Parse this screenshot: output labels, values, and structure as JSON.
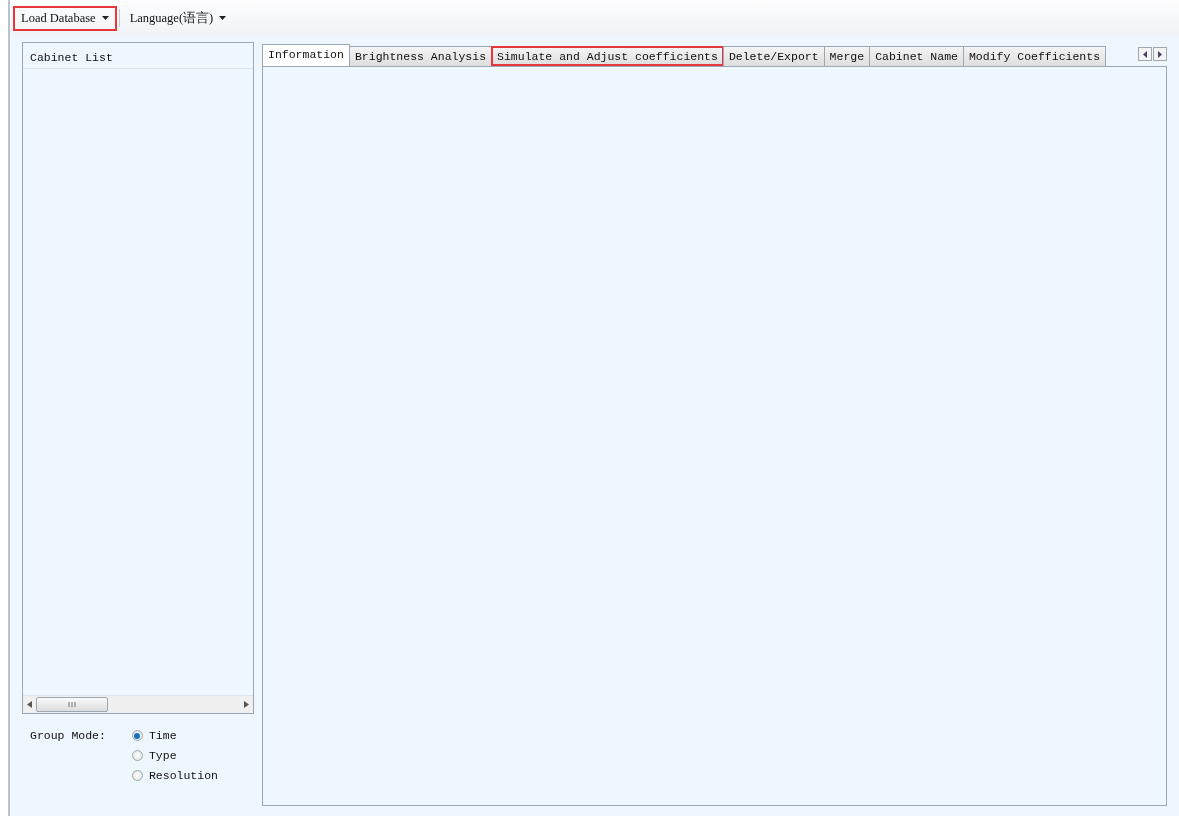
{
  "toolbar": {
    "menus": [
      {
        "label": "Load Database",
        "highlighted": true
      },
      {
        "label": "Language(语言)",
        "highlighted": false
      }
    ]
  },
  "cabinet_list": {
    "header": "Cabinet List"
  },
  "group_mode": {
    "label": "Group Mode:",
    "options": [
      {
        "label": "Time",
        "selected": true
      },
      {
        "label": "Type",
        "selected": false
      },
      {
        "label": "Resolution",
        "selected": false
      }
    ]
  },
  "tabs": [
    {
      "label": "Information",
      "selected": true,
      "highlighted": false
    },
    {
      "label": "Brightness Analysis",
      "selected": false,
      "highlighted": false
    },
    {
      "label": "Simulate and Adjust coefficients",
      "selected": false,
      "highlighted": true
    },
    {
      "label": "Delete/Export",
      "selected": false,
      "highlighted": false
    },
    {
      "label": "Merge",
      "selected": false,
      "highlighted": false
    },
    {
      "label": "Cabinet Name",
      "selected": false,
      "highlighted": false
    },
    {
      "label": "Modify Coefficients",
      "selected": false,
      "highlighted": false
    }
  ]
}
